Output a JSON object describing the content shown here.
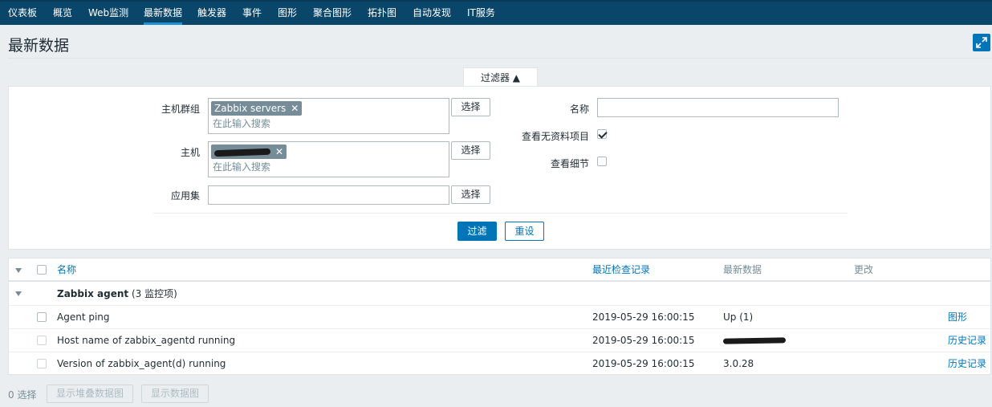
{
  "nav": {
    "items": [
      "仪表板",
      "概览",
      "Web监测",
      "最新数据",
      "触发器",
      "事件",
      "图形",
      "聚合图形",
      "拓扑图",
      "自动发现",
      "IT服务"
    ],
    "active": "最新数据"
  },
  "header": {
    "title": "最新数据"
  },
  "filter": {
    "tab_label": "过滤器 ▲",
    "host_groups_label": "主机群组",
    "host_groups_tag": "Zabbix servers",
    "search_placeholder": "在此输入搜索",
    "hosts_label": "主机",
    "applications_label": "应用集",
    "select_label": "选择",
    "name_label": "名称",
    "name_value": "",
    "show_without_data_label": "查看无资料项目",
    "show_without_data_checked": true,
    "show_details_label": "查看细节",
    "show_details_checked": false,
    "apply_label": "过滤",
    "reset_label": "重设"
  },
  "table": {
    "columns": {
      "name": "名称",
      "last_check": "最近检查记录",
      "last_value": "最新数据",
      "change": "更改"
    },
    "group": {
      "name": "Zabbix agent",
      "count": "(3 监控项)"
    },
    "rows": [
      {
        "name": "Agent ping",
        "last_check": "2019-05-29 16:00:15",
        "last_value": "Up (1)",
        "action": "图形"
      },
      {
        "name": "Host name of zabbix_agentd running",
        "last_check": "2019-05-29 16:00:15",
        "last_value": "",
        "action": "历史记录"
      },
      {
        "name": "Version of zabbix_agent(d) running",
        "last_check": "2019-05-29 16:00:15",
        "last_value": "3.0.28",
        "action": "历史记录"
      }
    ]
  },
  "footer": {
    "selected": "0 选择",
    "stacked_graph": "显示堆叠数据图",
    "graph": "显示数据图"
  },
  "colors": {
    "nav_bg": "#0a466a",
    "accent": "#0275b8",
    "tag_bg": "#768d99"
  }
}
